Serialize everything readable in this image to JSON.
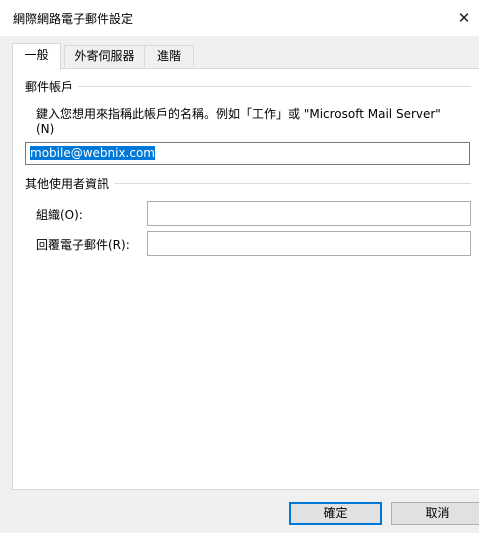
{
  "window": {
    "title": "網際網路電子郵件設定",
    "close_glyph": "✕"
  },
  "tabs": [
    {
      "label": "一般",
      "active": true
    },
    {
      "label": "外寄伺服器",
      "active": false
    },
    {
      "label": "進階",
      "active": false
    }
  ],
  "mail_account": {
    "group_label": "郵件帳戶",
    "description": "鍵入您想用來指稱此帳戶的名稱。例如「工作」或 \"Microsoft Mail Server\"(N)",
    "account_name_value": "mobile@webnix.com"
  },
  "other_user_info": {
    "group_label": "其他使用者資訊",
    "organization_label": "組織(O):",
    "organization_value": "",
    "reply_email_label": "回覆電子郵件(R):",
    "reply_email_value": ""
  },
  "buttons": {
    "ok_label": "確定",
    "cancel_label": "取消"
  },
  "colors": {
    "selection": "#0078d7",
    "default_button_border": "#0078d7",
    "button_face": "#e1e1e1",
    "dialog_background": "#f0f0f0"
  }
}
